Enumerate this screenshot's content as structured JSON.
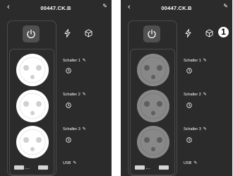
{
  "colors": {
    "background": "#2b2b2b",
    "socket_on": "#ffffff",
    "socket_off": "#888888",
    "text": "#ffffff"
  },
  "screens": [
    {
      "state": "on",
      "header": {
        "back_icon": "chevron-left-icon",
        "title": "00447.CK.B",
        "edit_icon": "pencil-icon"
      },
      "top_icons": [
        "bolt-icon",
        "cube-icon"
      ],
      "channels": [
        {
          "label": "Schalter 1"
        },
        {
          "label": "Schalter 2"
        },
        {
          "label": "Schalter 3"
        },
        {
          "label": "USB"
        }
      ]
    },
    {
      "state": "off",
      "badge": "1",
      "header": {
        "back_icon": "chevron-left-icon",
        "title": "00447.CK.B",
        "edit_icon": "pencil-icon"
      },
      "top_icons": [
        "bolt-icon",
        "cube-icon"
      ],
      "channels": [
        {
          "label": "Schalter 1"
        },
        {
          "label": "Schalter 2"
        },
        {
          "label": "Schalter 3"
        },
        {
          "label": "USB"
        }
      ]
    }
  ]
}
